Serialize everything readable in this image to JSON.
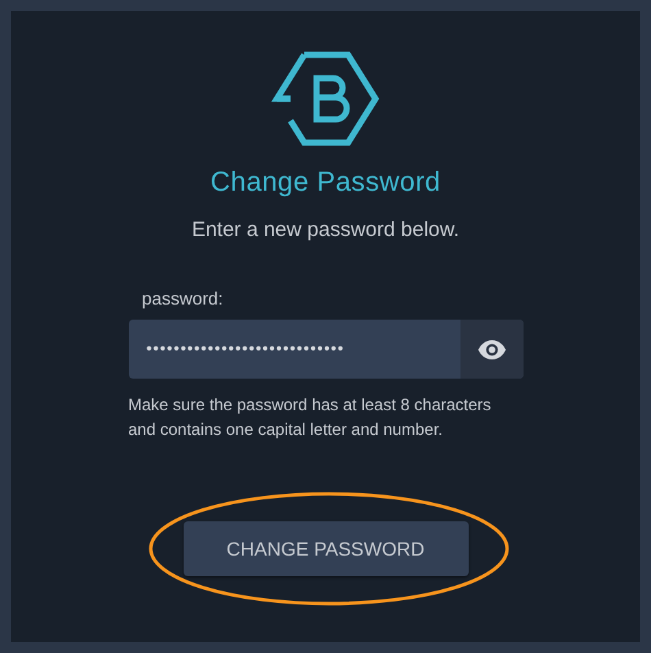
{
  "title": "Change Password",
  "subtitle": "Enter a new password below.",
  "password_field": {
    "label": "password:",
    "value": "•••••••••••••••••••••••••••••",
    "hint": "Make sure the password has at least 8 characters and contains one capital letter and number."
  },
  "button": "CHANGE PASSWORD"
}
